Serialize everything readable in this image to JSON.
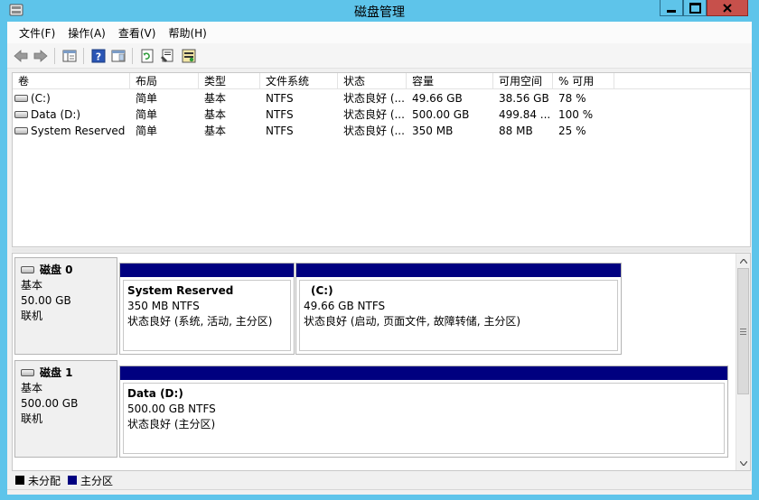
{
  "window": {
    "title": "磁盘管理"
  },
  "menu": [
    {
      "id": "file",
      "label": "文件(F)"
    },
    {
      "id": "action",
      "label": "操作(A)"
    },
    {
      "id": "view",
      "label": "查看(V)"
    },
    {
      "id": "help",
      "label": "帮助(H)"
    }
  ],
  "toolbar": {
    "icons": [
      "back-arrow-icon",
      "forward-arrow-icon",
      "show-hide-tree-icon",
      "help-icon",
      "properties-pane-icon",
      "refresh-icon",
      "properties-icon",
      "rescan-disks-icon"
    ]
  },
  "volume_table": {
    "columns": [
      "卷",
      "布局",
      "类型",
      "文件系统",
      "状态",
      "容量",
      "可用空间",
      "% 可用"
    ],
    "rows": [
      {
        "volume": "(C:)",
        "layout": "简单",
        "type": "基本",
        "fs": "NTFS",
        "status": "状态良好 (...",
        "capacity": "49.66 GB",
        "free": "38.56 GB",
        "pct": "78 %"
      },
      {
        "volume": "Data (D:)",
        "layout": "简单",
        "type": "基本",
        "fs": "NTFS",
        "status": "状态良好 (...",
        "capacity": "500.00 GB",
        "free": "499.84 ...",
        "pct": "100 %"
      },
      {
        "volume": "System Reserved",
        "layout": "简单",
        "type": "基本",
        "fs": "NTFS",
        "status": "状态良好 (...",
        "capacity": "350 MB",
        "free": "88 MB",
        "pct": "25 %"
      }
    ]
  },
  "disks": [
    {
      "name": "磁盘 0",
      "type": "基本",
      "size": "50.00 GB",
      "state": "联机",
      "partitions": [
        {
          "title": "System Reserved",
          "size_fs": "350 MB NTFS",
          "status": "状态良好 (系统, 活动, 主分区)"
        },
        {
          "title": "(C:)",
          "size_fs": "49.66 GB NTFS",
          "status": "状态良好 (启动, 页面文件, 故障转储, 主分区)"
        }
      ]
    },
    {
      "name": "磁盘 1",
      "type": "基本",
      "size": "500.00 GB",
      "state": "联机",
      "partitions": [
        {
          "title": "Data  (D:)",
          "size_fs": "500.00 GB NTFS",
          "status": "状态良好 (主分区)"
        }
      ]
    }
  ],
  "legend": [
    {
      "label": "未分配",
      "color": "#000000"
    },
    {
      "label": "主分区",
      "color": "#000080"
    }
  ],
  "colors": {
    "titlebar": "#5ec4ea",
    "primary_partition": "#000080",
    "close_button": "#c7504b"
  }
}
